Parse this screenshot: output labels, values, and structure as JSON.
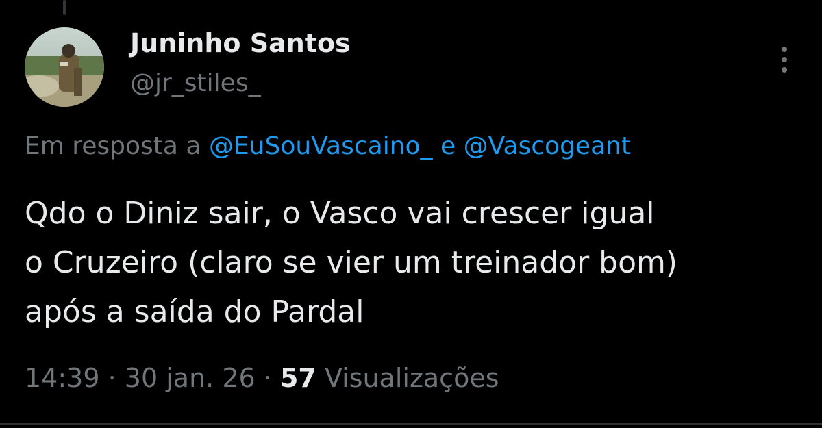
{
  "author": {
    "display_name": "Juninho Santos",
    "handle": "@jr_stiles_"
  },
  "reply": {
    "prefix": "Em resposta a",
    "mention_1": "@EuSouVascaino_",
    "conjunction": "e",
    "mention_2": "@Vascogeant"
  },
  "tweet": {
    "lines": [
      "Qdo o Diniz sair, o Vasco vai crescer igual",
      "o Cruzeiro (claro se vier um treinador bom)",
      "após a saída do Pardal"
    ]
  },
  "meta": {
    "time": "14:39",
    "separator": "·",
    "date": "30 jan. 26",
    "views_count": "57",
    "views_label": "Visualizações"
  },
  "icons": {
    "more": "more-vertical-icon"
  },
  "colors": {
    "background": "#000000",
    "text": "#e7e9ea",
    "muted": "#71767b",
    "link": "#1d9bf0"
  }
}
